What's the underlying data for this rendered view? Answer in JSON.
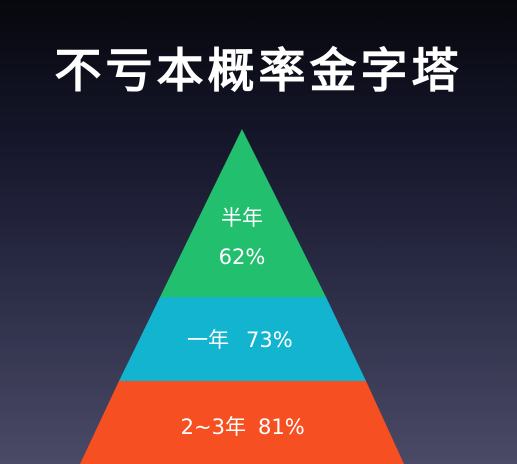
{
  "slide": {
    "title": "不亏本概率金字塔"
  },
  "tiers": [
    {
      "period": "半年",
      "probability": "62%",
      "color": "#22bf6e"
    },
    {
      "period": "一年",
      "probability": "73%",
      "color": "#12b4d0"
    },
    {
      "period": "2~3年",
      "probability": "81%",
      "color": "#f64f22"
    }
  ]
}
